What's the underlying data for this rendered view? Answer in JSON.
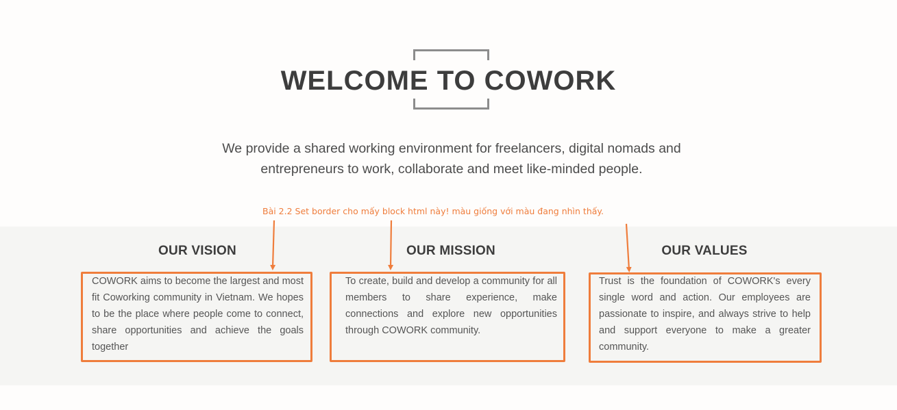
{
  "hero": {
    "title": "WELCOME TO COWORK",
    "description": "We provide a shared working environment for freelancers, digital nomads and entrepreneurs to work, collaborate and meet like-minded people."
  },
  "annotation": {
    "text": "Bài 2.2 Set border cho mấy block html này! màu giống với màu đang nhìn thấy.",
    "color": "#ef7d3c"
  },
  "columns": [
    {
      "title": "OUR VISION",
      "text": "COWORK aims to become the largest and most fit Coworking community in Vietnam. We hopes to be the place where people come to connect, share opportunities and achieve the goals together"
    },
    {
      "title": "OUR MISSION",
      "text": "To create, build and develop a community for all members to share experience, make connections and explore new opportunities through COWORK community."
    },
    {
      "title": "OUR VALUES",
      "text": "Trust is the foundation of COWORK's every single word and action. Our employees are passionate to inspire, and always strive to help and support everyone to make a greater community."
    }
  ],
  "colors": {
    "accent": "#ef7d3c",
    "band": "#f5f5f3",
    "bracket": "#8c8c8c",
    "heading": "#3d3d3d"
  }
}
